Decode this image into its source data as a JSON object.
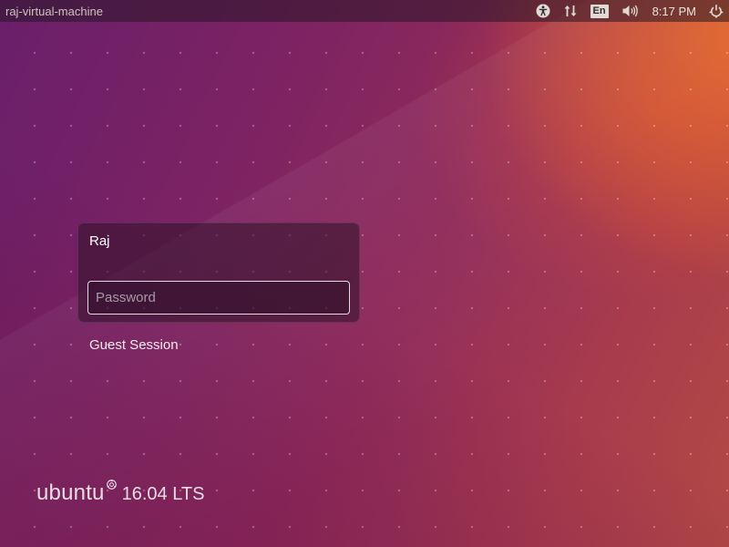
{
  "topbar": {
    "hostname": "raj-virtual-machine",
    "indicators": {
      "accessibility_icon": "accessibility-icon",
      "network_icon": "network-updown-icon",
      "keyboard_language": "En",
      "volume_icon": "volume-icon",
      "clock": "8:17 PM",
      "power_icon": "power-gear-icon"
    }
  },
  "login": {
    "username": "Raj",
    "password_placeholder": "Password",
    "password_value": "",
    "guest_session_label": "Guest Session"
  },
  "branding": {
    "word": "ubuntu",
    "version": "16.04 LTS",
    "logo_icon": "circle-of-friends-icon"
  },
  "colors": {
    "background_left": "#6a1f6a",
    "background_right": "#eb6e28",
    "panel": "#2d1228",
    "text": "#ffffff"
  }
}
